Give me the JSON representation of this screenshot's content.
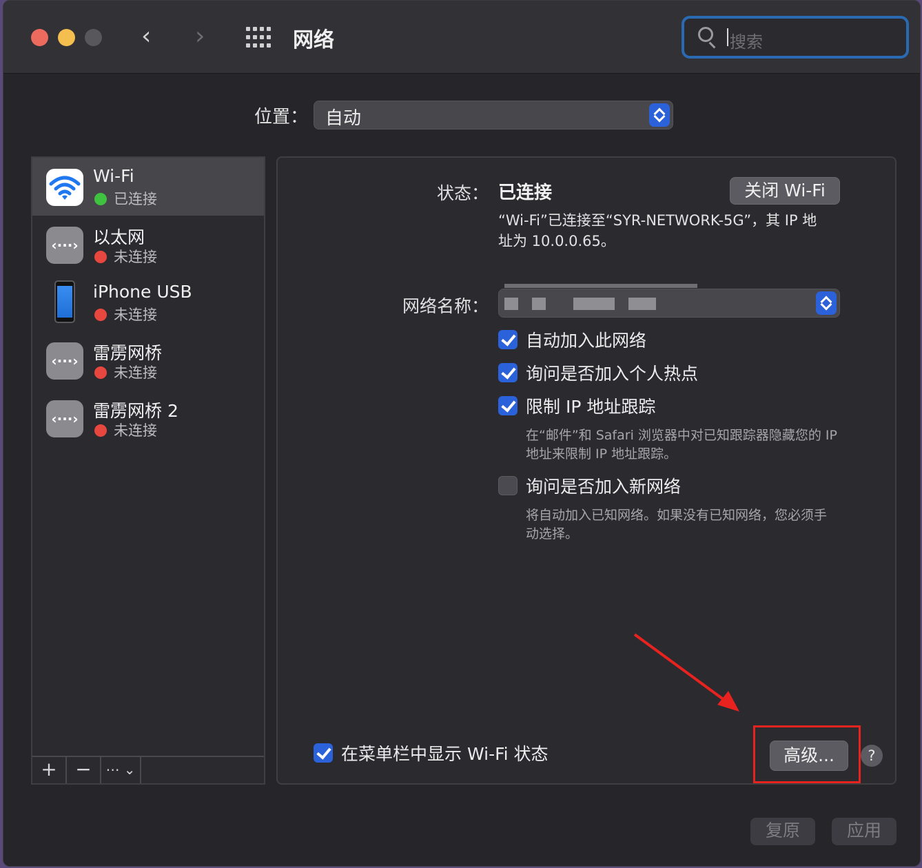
{
  "window": {
    "title": "网络"
  },
  "search": {
    "placeholder": "搜索"
  },
  "location": {
    "label": "位置：",
    "value": "自动"
  },
  "services": [
    {
      "name": "Wi-Fi",
      "status": "已连接",
      "status_color": "#3fc23f",
      "icon": "wifi-icon"
    },
    {
      "name": "以太网",
      "status": "未连接",
      "status_color": "#e8473f",
      "icon": "ethernet-icon"
    },
    {
      "name": "iPhone USB",
      "status": "未连接",
      "status_color": "#e8473f",
      "icon": "iphone-icon"
    },
    {
      "name": "雷雳网桥",
      "status": "未连接",
      "status_color": "#e8473f",
      "icon": "ethernet-icon"
    },
    {
      "name": "雷雳网桥 2",
      "status": "未连接",
      "status_color": "#e8473f",
      "icon": "ethernet-icon"
    }
  ],
  "toolbar": {
    "add": "+",
    "remove": "−",
    "more": "⋯"
  },
  "detail": {
    "status_label": "状态：",
    "status_value": "已连接",
    "toggle_wifi": "关闭 Wi-Fi",
    "status_desc_1": "“Wi-Fi”已连接至“SYR-NETWORK-5G”，其 IP 地",
    "status_desc_2": "址为 10.0.0.65。",
    "network_label": "网络名称：",
    "auto_join": "自动加入此网络",
    "ask_hotspot": "询问是否加入个人热点",
    "limit_ip": "限制 IP 地址跟踪",
    "limit_ip_desc_1": "在“邮件”和 Safari 浏览器中对已知跟踪器隐藏您的 IP",
    "limit_ip_desc_2": "地址来限制 IP 地址跟踪。",
    "ask_new": "询问是否加入新网络",
    "ask_new_desc_1": "将自动加入已知网络。如果没有已知网络，您必须手",
    "ask_new_desc_2": "动选择。",
    "show_menubar": "在菜单栏中显示 Wi-Fi 状态",
    "advanced": "高级...",
    "help": "?"
  },
  "checkboxes": {
    "auto_join": true,
    "ask_hotspot": true,
    "limit_ip": true,
    "ask_new": false,
    "show_menubar": true
  },
  "footer": {
    "revert": "复原",
    "apply": "应用"
  },
  "colors": {
    "accent": "#2c62d9",
    "annotation": "#e8231f"
  }
}
